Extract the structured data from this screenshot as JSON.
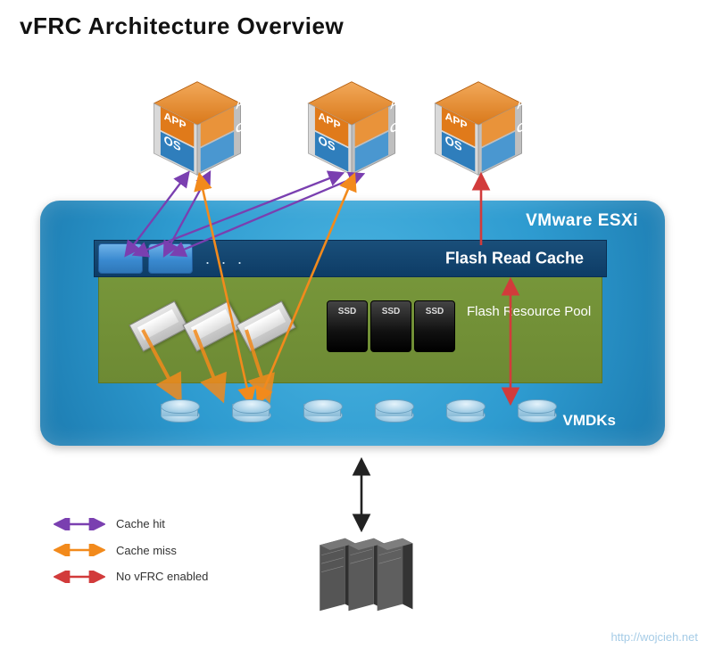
{
  "title": "vFRC Architecture Overview",
  "esxi_label": "VMware ESXi",
  "cache_label": "Flash Read Cache",
  "cache_dots": ". . .",
  "flash_pool_label": "Flash Resource Pool",
  "ssd_label": "SSD",
  "vmdks_label": "VMDKs",
  "cube": {
    "app": "APP",
    "os": "OS"
  },
  "legend": {
    "hit": "Cache hit",
    "miss": "Cache miss",
    "novfrc": "No vFRC enabled"
  },
  "colors": {
    "hit": "#7a3fb0",
    "miss": "#f28a1c",
    "novfrc": "#d23b3b",
    "cube_top": "#e07a1a",
    "cube_os": "#2f7ebc"
  },
  "watermark": "http://wojcieh.net"
}
